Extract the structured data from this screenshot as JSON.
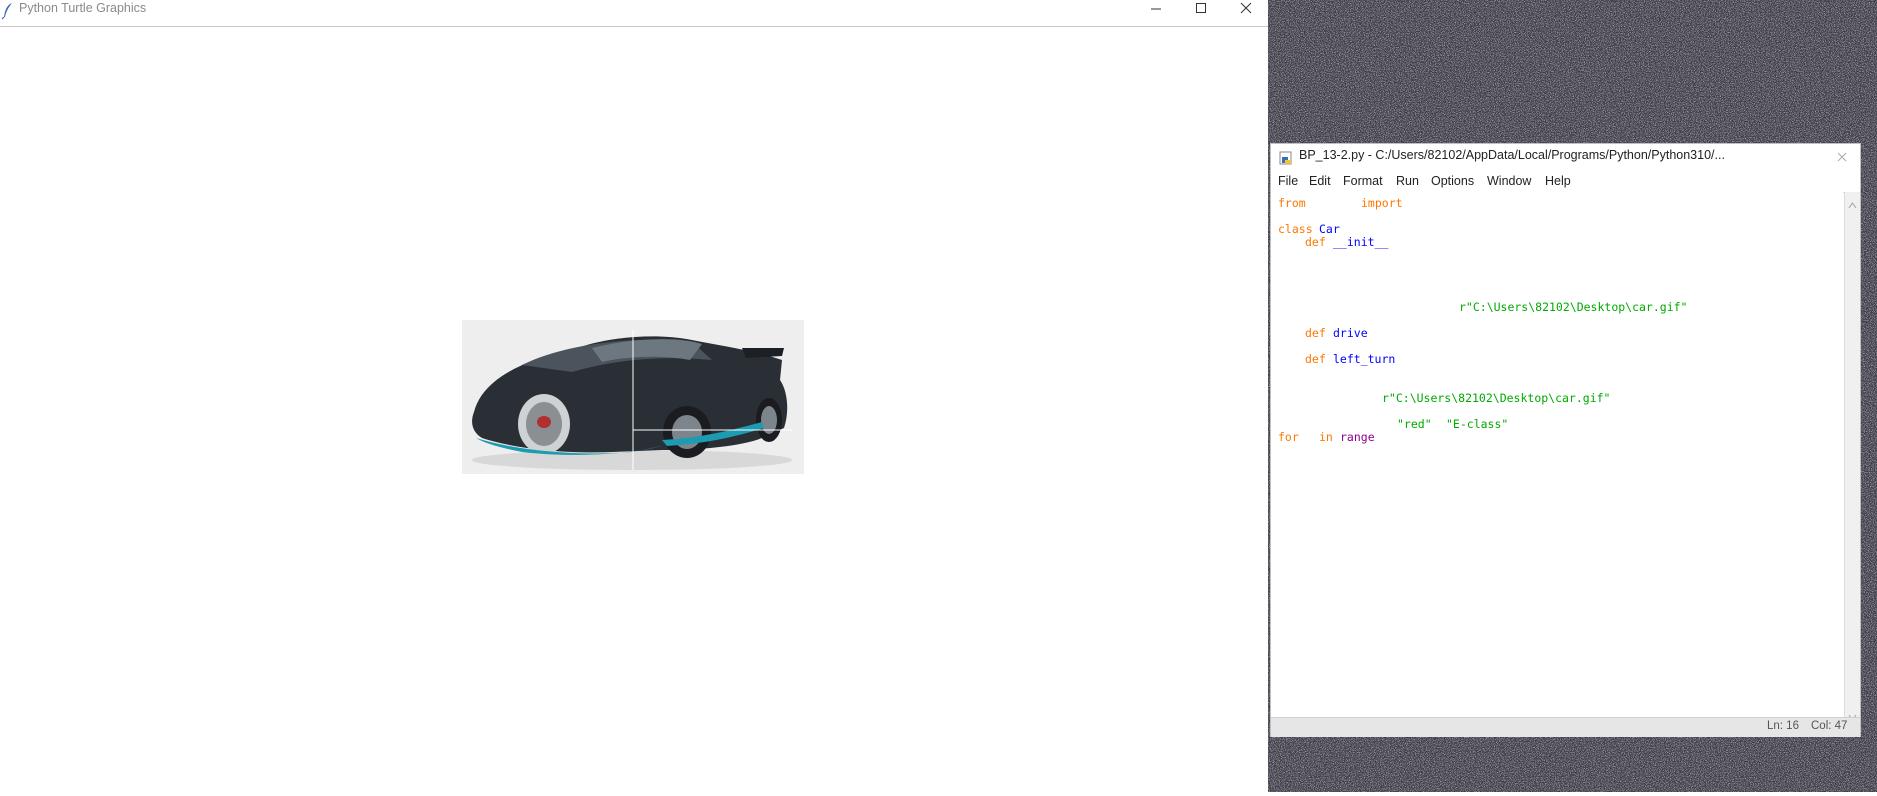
{
  "turtle_window": {
    "title": "Python Turtle Graphics"
  },
  "idle_window": {
    "title": "BP_13-2.py - C:/Users/82102/AppData/Local/Programs/Python/Python310/...",
    "menu": [
      "File",
      "Edit",
      "Format",
      "Run",
      "Options",
      "Window",
      "Help"
    ],
    "code_tokens": {
      "from_kw": "from",
      "import_kw": "import",
      "class_kw": "class",
      "class_name": "Car",
      "def1_kw": "def",
      "def1_name": "__init__",
      "str1": "r\"C:\\Users\\82102\\Desktop\\car.gif\"",
      "def2_kw": "def",
      "def2_name": "drive",
      "def3_kw": "def",
      "def3_name": "left_turn",
      "str2": "r\"C:\\Users\\82102\\Desktop\\car.gif\"",
      "str3": "\"red\"",
      "str4": "\"E-class\"",
      "for_kw": "for",
      "in_kw": "in",
      "range_bi": "range"
    },
    "status": {
      "line": "Ln: 16",
      "col": "Col: 47"
    }
  },
  "colors": {
    "keyword": "#ff7700",
    "definition": "#0000ff",
    "string": "#00aa00",
    "builtin": "#900090"
  }
}
